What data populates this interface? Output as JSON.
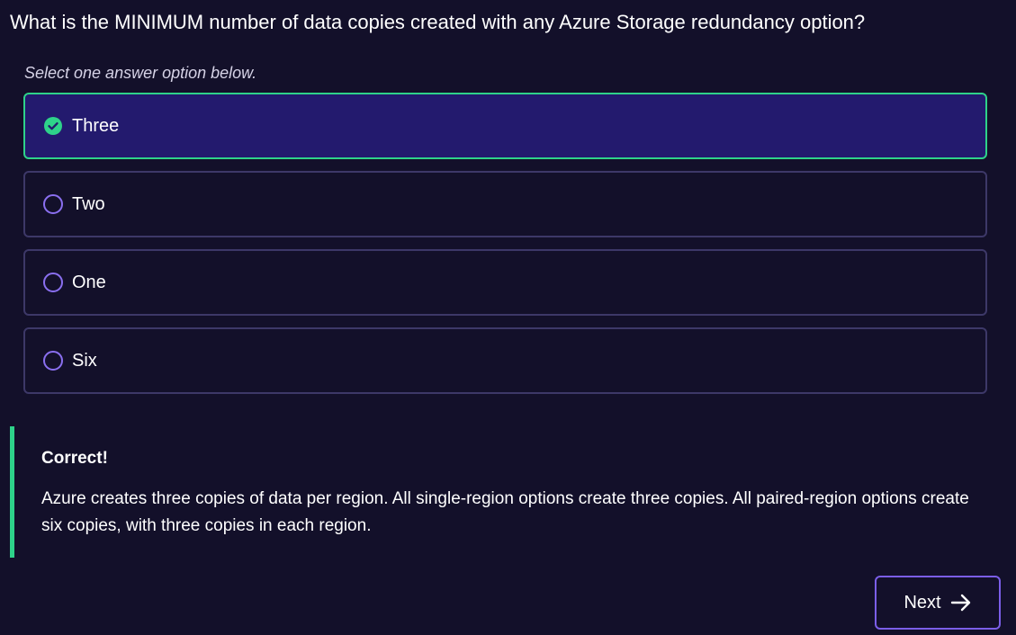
{
  "question": {
    "text": "What is the MINIMUM number of data copies created with any Azure Storage redundancy option?",
    "instruction": "Select one answer option below."
  },
  "options": [
    {
      "label": "Three",
      "selected": true
    },
    {
      "label": "Two",
      "selected": false
    },
    {
      "label": "One",
      "selected": false
    },
    {
      "label": "Six",
      "selected": false
    }
  ],
  "feedback": {
    "title": "Correct!",
    "body": "Azure creates three copies of data per region. All single-region options create three copies. All paired-region options create six copies, with three copies in each region."
  },
  "navigation": {
    "next_label": "Next",
    "next_icon": "arrow-right-icon"
  },
  "colors": {
    "background": "#13102a",
    "selected_background": "#231a6e",
    "correct_accent": "#2ed28a",
    "radio_accent": "#8a6ff0",
    "option_border": "#3d3868",
    "button_border": "#7b5ee8"
  }
}
